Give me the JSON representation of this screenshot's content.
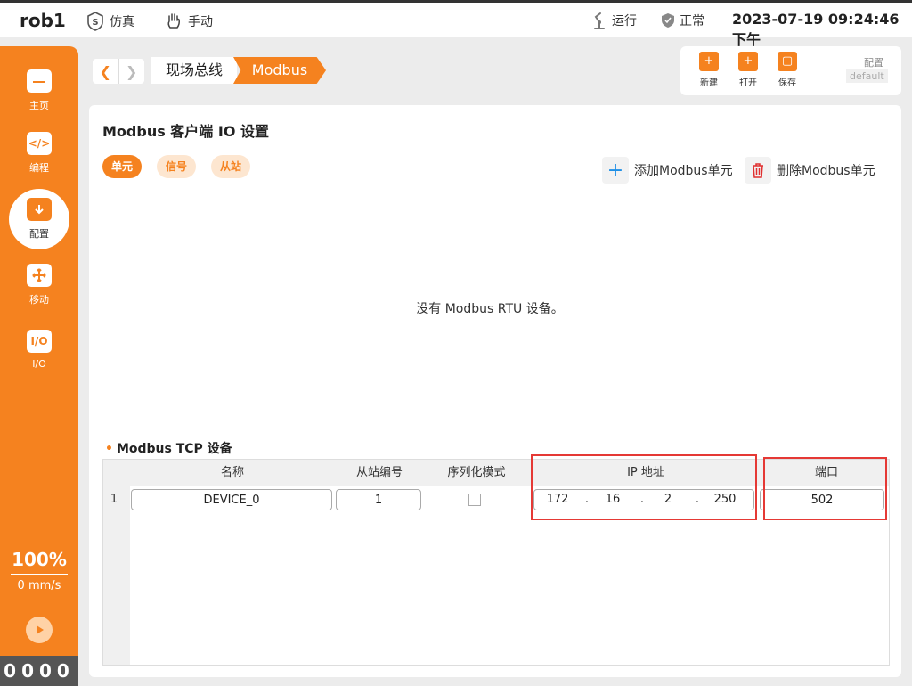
{
  "topbar": {
    "robot_name": "rob1",
    "mode_sim": "仿真",
    "mode_manual": "手动",
    "run_state": "运行",
    "status": "正常",
    "datetime": "2023-07-19 09:24:46 下午"
  },
  "sidebar": {
    "items": [
      {
        "label": "主页",
        "icon": "home-icon"
      },
      {
        "label": "编程",
        "icon": "code-icon"
      },
      {
        "label": "配置",
        "icon": "config-icon"
      },
      {
        "label": "移动",
        "icon": "move-icon"
      },
      {
        "label": "I/O",
        "icon": "io-icon"
      }
    ],
    "io_icon_text": "I/O",
    "speed_percent": "100%",
    "speed_value": "0 mm/s",
    "io_counter": "0000"
  },
  "breadcrumb": {
    "level1": "现场总线",
    "level2": "Modbus"
  },
  "file_toolbar": {
    "new_label": "新建",
    "open_label": "打开",
    "save_label": "保存",
    "config_label": "配置",
    "config_value": "default"
  },
  "panel": {
    "title": "Modbus 客户端 IO 设置",
    "tabs": [
      "单元",
      "信号",
      "从站"
    ],
    "add_label": "添加Modbus单元",
    "delete_label": "删除Modbus单元",
    "empty_message": "没有 Modbus RTU 设备。"
  },
  "tcp_section": {
    "title": "Modbus TCP 设备",
    "headers": {
      "name": "名称",
      "slave_id": "从站编号",
      "serial_mode": "序列化模式",
      "ip": "IP 地址",
      "port": "端口"
    },
    "rows": [
      {
        "index": "1",
        "name": "DEVICE_0",
        "slave_id": "1",
        "serial_mode": false,
        "ip": [
          "172",
          "16",
          "2",
          "250"
        ],
        "ip_separator": ".",
        "port": "502"
      }
    ]
  },
  "colors": {
    "accent": "#f5821f",
    "highlight": "#e53935",
    "add_icon": "#1e8fe6",
    "delete_icon": "#e03030"
  }
}
